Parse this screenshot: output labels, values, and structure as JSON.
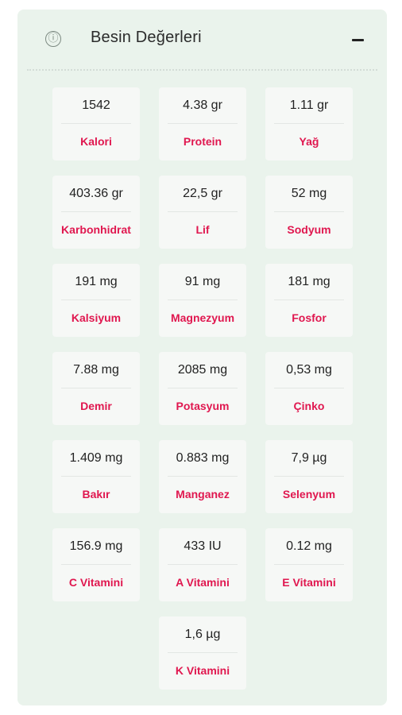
{
  "panel": {
    "title": "Besin Değerleri",
    "info_glyph": "ⓘ",
    "icons": {
      "info": "info-circle-icon",
      "collapse": "minus-icon"
    },
    "colors": {
      "background": "#eaf3ec",
      "label": "#e0174f",
      "card": "#f6f8f6"
    }
  },
  "nutrients": [
    {
      "value": "1542",
      "label": "Kalori"
    },
    {
      "value": "4.38 gr",
      "label": "Protein"
    },
    {
      "value": "1.11 gr",
      "label": "Yağ"
    },
    {
      "value": "403.36 gr",
      "label": "Karbonhidrat"
    },
    {
      "value": "22,5 gr",
      "label": "Lif"
    },
    {
      "value": "52 mg",
      "label": "Sodyum"
    },
    {
      "value": "191 mg",
      "label": "Kalsiyum"
    },
    {
      "value": "91 mg",
      "label": "Magnezyum"
    },
    {
      "value": "181 mg",
      "label": "Fosfor"
    },
    {
      "value": "7.88 mg",
      "label": "Demir"
    },
    {
      "value": "2085 mg",
      "label": "Potasyum"
    },
    {
      "value": "0,53 mg",
      "label": "Çinko"
    },
    {
      "value": "1.409 mg",
      "label": "Bakır"
    },
    {
      "value": "0.883 mg",
      "label": "Manganez"
    },
    {
      "value": "7,9 µg",
      "label": "Selenyum"
    },
    {
      "value": "156.9 mg",
      "label": "C Vitamini"
    },
    {
      "value": "433 IU",
      "label": "A Vitamini"
    },
    {
      "value": "0.12 mg",
      "label": "E Vitamini"
    },
    {
      "value": "1,6 µg",
      "label": "K Vitamini"
    }
  ]
}
